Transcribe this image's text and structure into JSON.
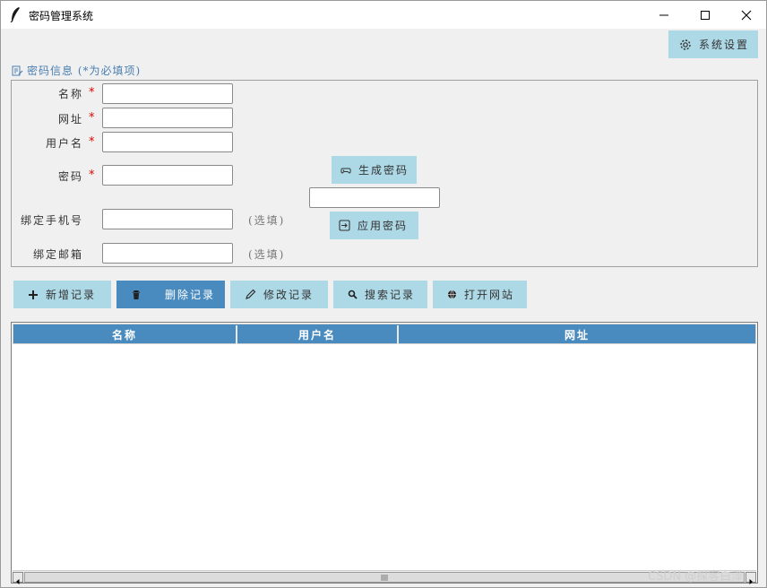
{
  "window": {
    "title": "密码管理系统"
  },
  "toolbar": {
    "settings_label": "系统设置"
  },
  "form": {
    "section_title": "密码信息 (*为必填项)",
    "required_mark": "*",
    "name_label": "名称",
    "url_label": "网址",
    "username_label": "用户名",
    "password_label": "密码",
    "phone_label": "绑定手机号",
    "email_label": "绑定邮箱",
    "optional_text": "(选填)",
    "name_value": "",
    "url_value": "",
    "username_value": "",
    "password_value": "",
    "phone_value": "",
    "email_value": "",
    "generate_label": "生成密码",
    "generated_value": "",
    "apply_label": "应用密码"
  },
  "actions": {
    "add_label": "新增记录",
    "delete_label": "删除记录",
    "edit_label": "修改记录",
    "search_label": "搜索记录",
    "open_label": "打开网站"
  },
  "table": {
    "columns": [
      "名称",
      "用户名",
      "网址"
    ],
    "rows": []
  },
  "watermark": "CSDN @探客白泽"
}
